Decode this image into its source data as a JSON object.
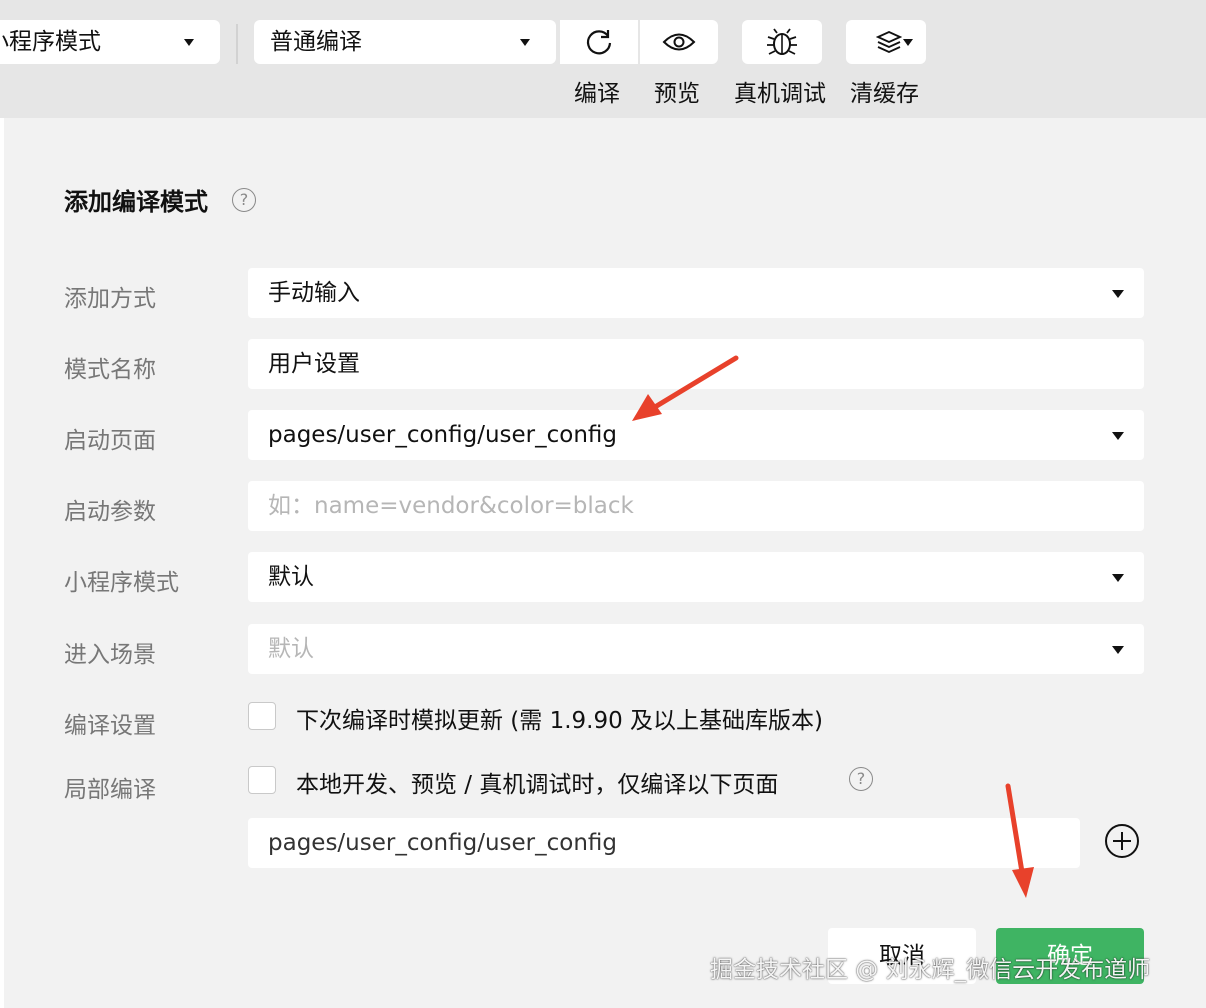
{
  "toolbar": {
    "mode_select": "小程序模式",
    "compile_select": "普通编译",
    "compile_label": "编译",
    "preview_label": "预览",
    "debug_label": "真机调试",
    "cache_label": "清缓存"
  },
  "dialog": {
    "title": "添加编译模式",
    "help_glyph": "?",
    "fields": {
      "add_method": {
        "label": "添加方式",
        "value": "手动输入"
      },
      "mode_name": {
        "label": "模式名称",
        "value": "用户设置"
      },
      "launch_page": {
        "label": "启动页面",
        "value": "pages/user_config/user_config"
      },
      "launch_params": {
        "label": "启动参数",
        "placeholder": "如：name=vendor&color=black"
      },
      "miniprogram_mode": {
        "label": "小程序模式",
        "value": "默认"
      },
      "scene": {
        "label": "进入场景",
        "placeholder": "默认"
      }
    },
    "compile_settings": {
      "label": "编译设置",
      "option": "下次编译时模拟更新 (需 1.9.90 及以上基础库版本)",
      "checked": false
    },
    "partial_compile": {
      "label": "局部编译",
      "option": "本地开发、预览 / 真机调试时，仅编译以下页面",
      "checked": false,
      "page": "pages/user_config/user_config"
    },
    "cancel_label": "取消",
    "confirm_label": "确定"
  },
  "watermark": "掘金技术社区 @ 刘永辉_微信云开发布道师",
  "colors": {
    "confirm": "#3fb463",
    "annotation_arrow": "#e8412b"
  },
  "icons": [
    "chevron-down-icon",
    "refresh-icon",
    "eye-icon",
    "bug-icon",
    "layers-icon",
    "help-icon",
    "add-circle-icon",
    "annotation-arrow"
  ]
}
